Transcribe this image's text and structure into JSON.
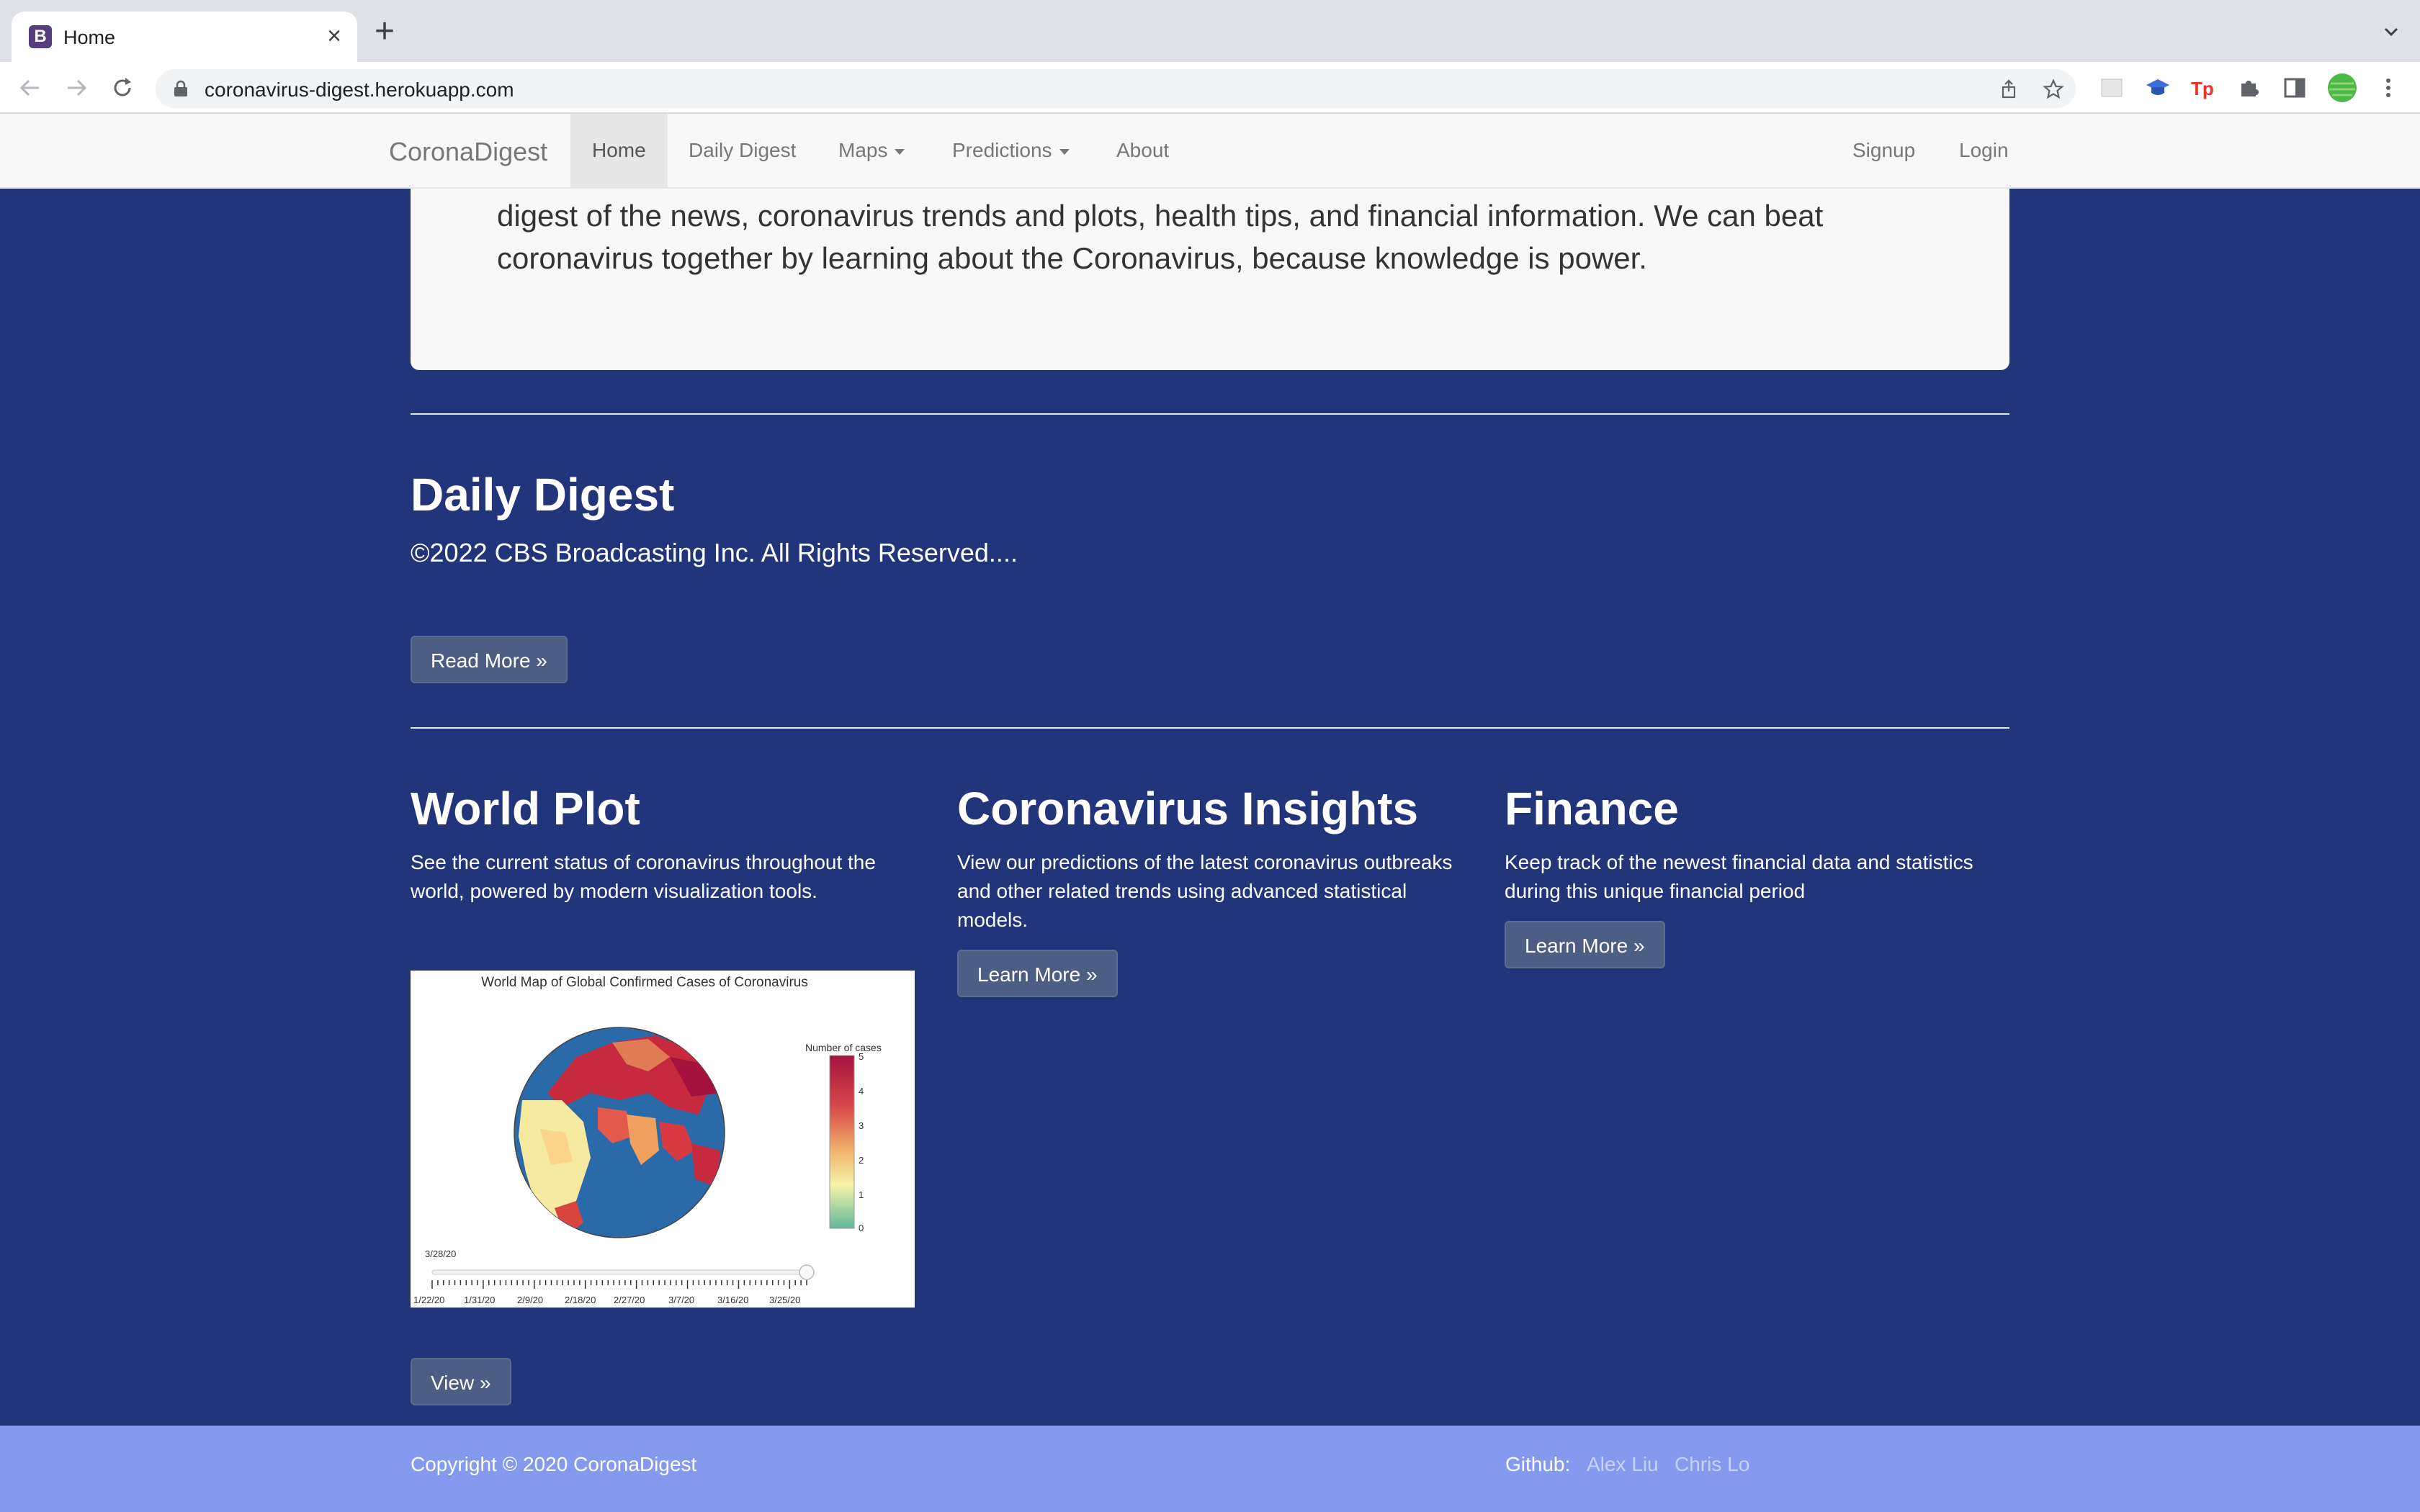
{
  "browser": {
    "tab_title": "Home",
    "tab_favicon_letter": "B",
    "url": "coronavirus-digest.herokuapp.com",
    "icons": [
      "back-icon",
      "forward-icon",
      "reload-icon",
      "lock-icon",
      "share-icon",
      "bookmark-star-icon",
      "extension-icon",
      "extensions-puzzle-icon",
      "side-panel-icon",
      "profile-avatar-icon",
      "kebab-menu-icon"
    ]
  },
  "navbar": {
    "brand": "CoronaDigest",
    "items": [
      {
        "label": "Home",
        "active": true
      },
      {
        "label": "Daily Digest"
      },
      {
        "label": "Maps",
        "dropdown": true
      },
      {
        "label": "Predictions",
        "dropdown": true
      },
      {
        "label": "About"
      }
    ],
    "right": [
      {
        "label": "Signup"
      },
      {
        "label": "Login"
      }
    ]
  },
  "jumbotron": {
    "text": "digest of the news, coronavirus trends and plots, health tips, and financial information. We can beat coronavirus together by learning about the Coronavirus, because knowledge is power."
  },
  "daily_digest": {
    "title": "Daily Digest",
    "snippet": "©2022 CBS Broadcasting Inc. All Rights Reserved....",
    "button": "Read More »"
  },
  "world_plot": {
    "title": "World Plot",
    "description": "See the current status of coronavirus throughout the world, powered by modern visualization tools.",
    "button": "View »",
    "map": {
      "title": "World Map of Global Confirmed Cases of Coronavirus",
      "colorbar_title": "Number of cases",
      "colorbar_ticks": [
        "5",
        "4",
        "3",
        "2",
        "1",
        "0"
      ],
      "slider_current": "3/28/20",
      "slider_labels": [
        "1/22/20",
        "1/31/20",
        "2/9/20",
        "2/18/20",
        "2/27/20",
        "3/7/20",
        "3/16/20",
        "3/25/20"
      ]
    }
  },
  "insights": {
    "title": "Coronavirus Insights",
    "description": "View our predictions of the latest coronavirus outbreaks and other related trends using advanced statistical models.",
    "button": "Learn More »"
  },
  "finance": {
    "title": "Finance",
    "description": "Keep track of the newest financial data and statistics during this unique financial period",
    "button": "Learn More »"
  },
  "footer": {
    "copyright": "Copyright © 2020 CoronaDigest",
    "github_label": "Github:",
    "links": [
      "Alex Liu",
      "Chris Lo"
    ]
  },
  "colors": {
    "page_bg": "#22357a",
    "footer_bg": "#8599ef",
    "button_bg": "#4c5e83"
  }
}
